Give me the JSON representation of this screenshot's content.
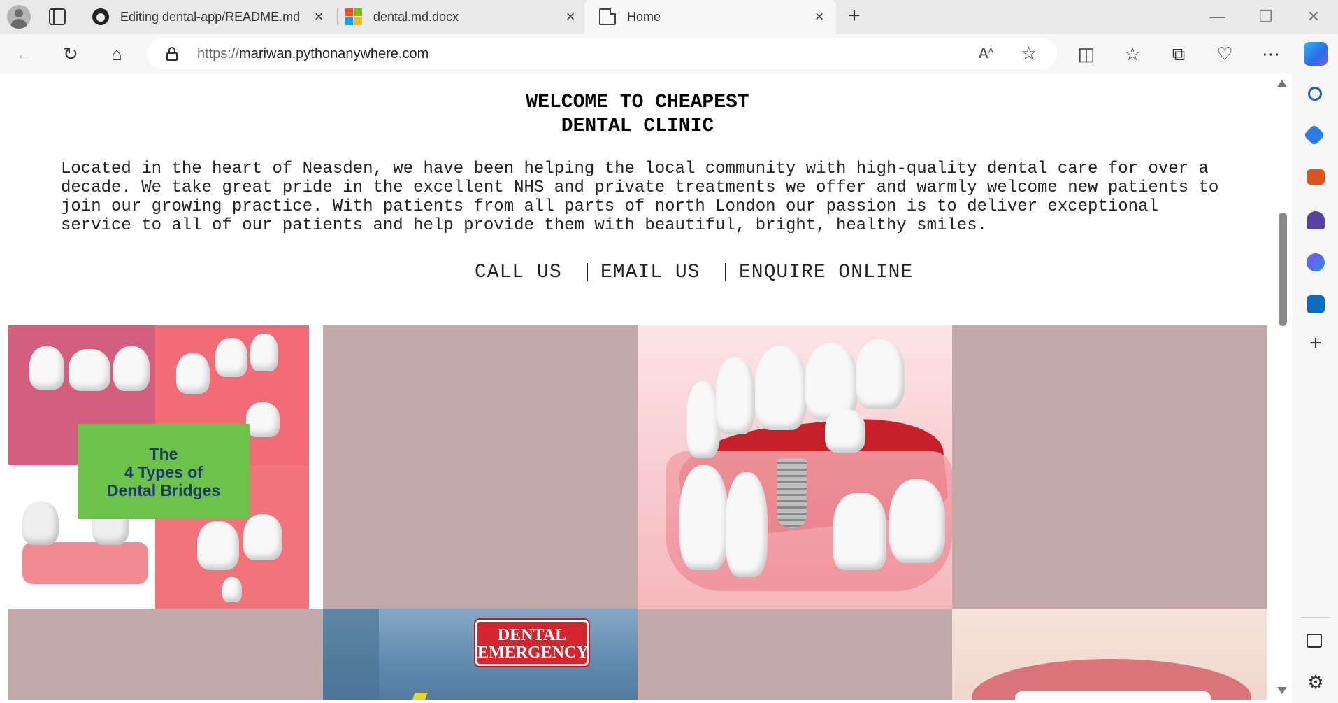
{
  "browser": {
    "tabs": [
      {
        "title": "Editing dental-app/README.md",
        "icon": "github-icon",
        "active": false
      },
      {
        "title": "dental.md.docx",
        "icon": "microsoft-icon",
        "active": false
      },
      {
        "title": "Home",
        "icon": "page-icon",
        "active": true
      }
    ],
    "address_bar": {
      "scheme": "https://",
      "host": "mariwan.pythonanywhere.com"
    },
    "read_aloud_glyph": "A̅"
  },
  "page": {
    "heading_line1": "WELCOME TO CHEAPEST",
    "heading_line2": "DENTAL CLINIC",
    "intro": "Located in the heart of Neasden, we have been helping the local community with high-quality dental care for over a decade. We take great pride in the excellent NHS and private treatments we offer and warmly welcome new patients to join our growing practice. With patients from all parts of north London our passion is to deliver exceptional service to all of our patients and help provide them with beautiful, bright, healthy smiles.",
    "contact_links": [
      "CALL US",
      "EMAIL US",
      "ENQUIRE ONLINE"
    ],
    "gallery": {
      "tile_bg": "#c3a8aa",
      "bridges_label": [
        "The",
        "4 Types of",
        "Dental Bridges"
      ],
      "emergency_label": [
        "DENTAL",
        "EMERGENCY"
      ]
    }
  }
}
